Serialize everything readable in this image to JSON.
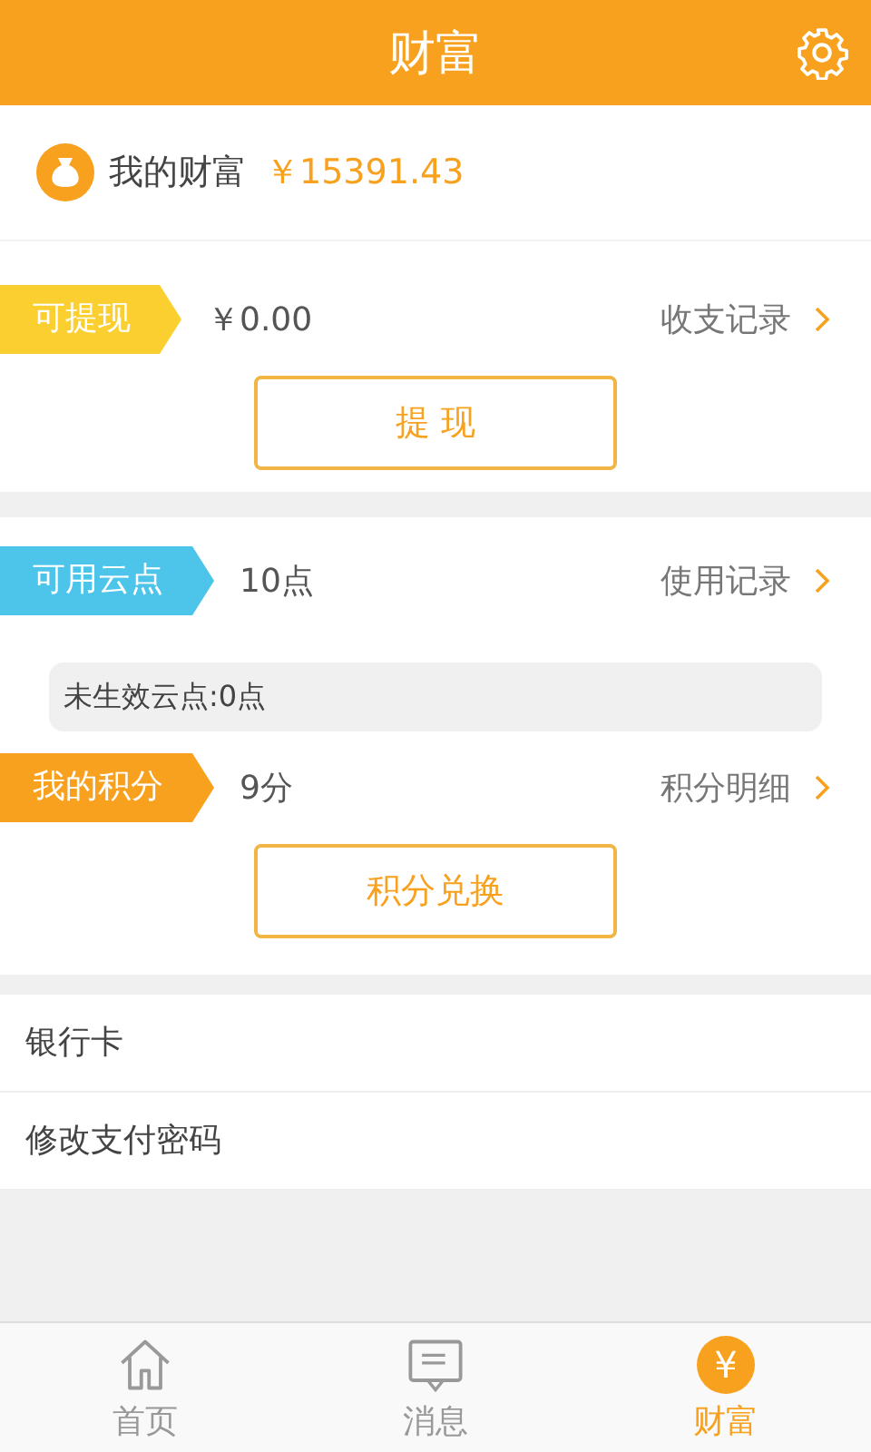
{
  "header": {
    "title": "财富"
  },
  "wealth": {
    "label": "我的财富",
    "amount": "￥15391.43"
  },
  "sections": [
    {
      "items": [
        {
          "kind": "row",
          "tag": "可提现",
          "color": "#fbcf2f",
          "value": "￥0.00",
          "link": "收支记录"
        },
        {
          "kind": "button",
          "label": "提 现"
        }
      ]
    },
    {
      "items": [
        {
          "kind": "row",
          "tag": "可用云点",
          "color": "#4dc4ea",
          "value": "10点",
          "link": "使用记录"
        },
        {
          "kind": "note",
          "text": "未生效云点:0点"
        },
        {
          "kind": "row",
          "tag": "我的积分",
          "color": "#f8a11f",
          "value": "9分",
          "link": "积分明细"
        },
        {
          "kind": "button",
          "label": "积分兑换"
        }
      ]
    }
  ],
  "menu": [
    "银行卡",
    "修改支付密码"
  ],
  "tabs": [
    {
      "label": "首页",
      "selected": false
    },
    {
      "label": "消息",
      "selected": false
    },
    {
      "label": "财富",
      "selected": true,
      "glyph": "¥"
    }
  ]
}
